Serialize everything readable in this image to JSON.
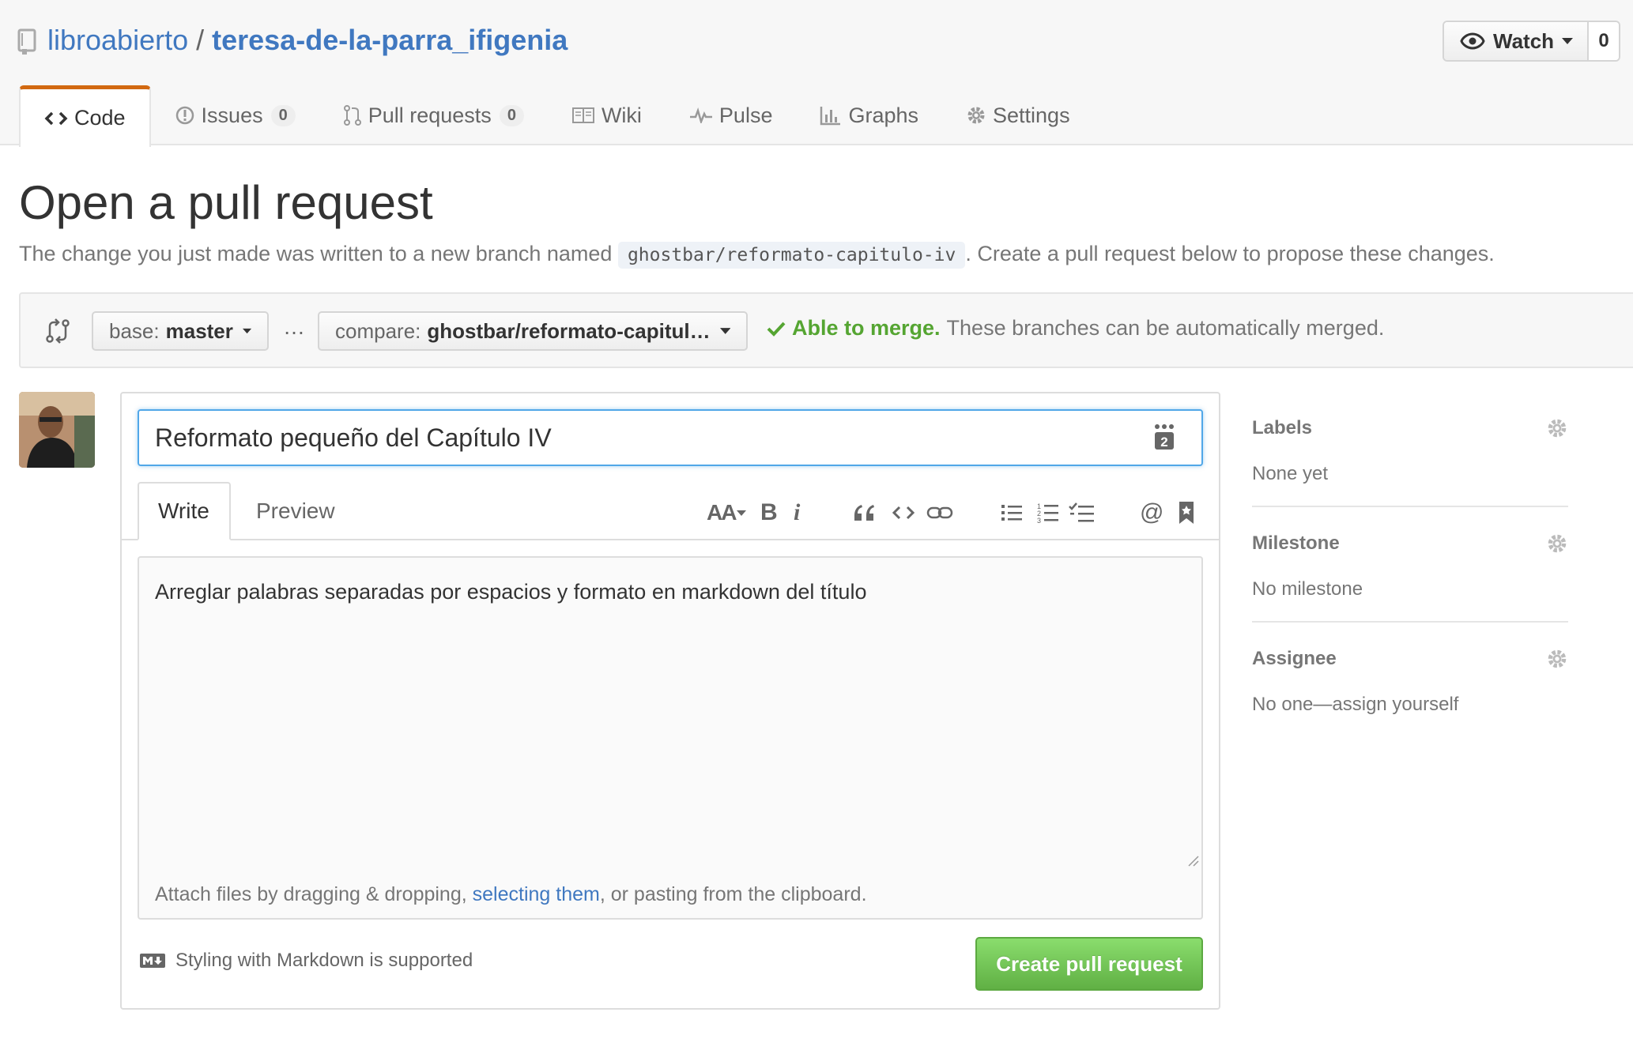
{
  "repo": {
    "owner": "libroabierto",
    "separator": "/",
    "name": "teresa-de-la-parra_ifigenia"
  },
  "watch": {
    "label": "Watch",
    "count": "0"
  },
  "tabs": [
    {
      "label": "Code"
    },
    {
      "label": "Issues",
      "counter": "0"
    },
    {
      "label": "Pull requests",
      "counter": "0"
    },
    {
      "label": "Wiki"
    },
    {
      "label": "Pulse"
    },
    {
      "label": "Graphs"
    },
    {
      "label": "Settings"
    }
  ],
  "page": {
    "title": "Open a pull request",
    "subtitle_before": "The change you just made was written to a new branch named ",
    "branch_code": "ghostbar/reformato-capitulo-iv",
    "subtitle_after": ". Create a pull request below to propose these changes."
  },
  "compare": {
    "base_prefix": "base:",
    "base_value": "master",
    "dots": "…",
    "compare_prefix": "compare:",
    "compare_value": "ghostbar/reformato-capitul…",
    "merge_ok": "Able to merge.",
    "merge_text": "These branches can be automatically merged."
  },
  "form": {
    "title_value": "Reformato pequeño del Capítulo IV",
    "emoji_badge": "2",
    "tab_write": "Write",
    "tab_preview": "Preview",
    "body_value": "Arreglar palabras separadas por espacios y formato en markdown del título",
    "attach_before": "Attach files by dragging & dropping, ",
    "attach_link": "selecting them",
    "attach_after": ", or pasting from the clipboard.",
    "markdown_note": "Styling with Markdown is supported",
    "submit_label": "Create pull request"
  },
  "toolbar": {
    "header_text": "AA",
    "bold_text": "B",
    "italic_text": "i",
    "mention_text": "@"
  },
  "sidebar": {
    "labels_heading": "Labels",
    "labels_value": "None yet",
    "milestone_heading": "Milestone",
    "milestone_value": "No milestone",
    "assignee_heading": "Assignee",
    "assignee_value": "No one—assign yourself"
  },
  "colors": {
    "link_blue": "#4078c0",
    "tab_accent": "#d26911",
    "merge_green": "#55a532",
    "button_green": "#60b044",
    "focus_blue": "#51a7e8"
  }
}
